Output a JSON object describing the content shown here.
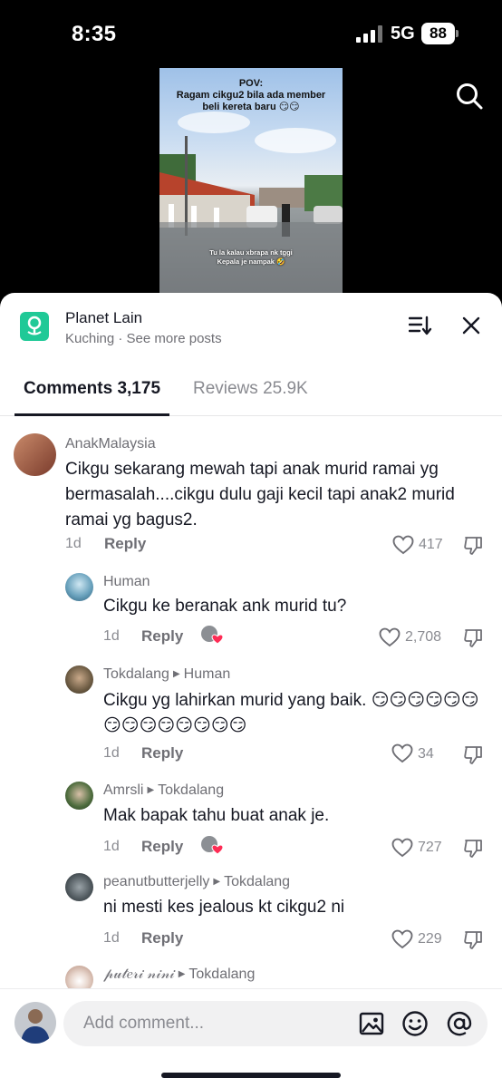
{
  "status_bar": {
    "time": "8:35",
    "network": "5G",
    "battery": "88"
  },
  "video": {
    "caption": "POV:\nRagam cikgu2 bila ada member\nbeli kereta baru 😏😏",
    "subtitle": "Tu la kalau xbrapa nk tggi\nKepala je nampak 🤣"
  },
  "shop": {
    "name": "Planet Lain",
    "meta": "Kuching · See more posts"
  },
  "tabs": [
    {
      "label": "Comments 3,175",
      "active": true
    },
    {
      "label": "Reviews 25.9K",
      "active": false
    }
  ],
  "comments": [
    {
      "user": "AnakMalaysia",
      "reply_to": "",
      "text": "Cikgu sekarang mewah tapi anak murid ramai yg bermasalah....cikgu dulu gaji kecil tapi anak2 murid ramai yg bagus2.",
      "date": "1d",
      "reply_label": "Reply",
      "likes": "417",
      "creator_liked": false
    },
    {
      "user": "Human",
      "reply_to": "",
      "text": "Cikgu ke beranak ank murid tu?",
      "date": "1d",
      "reply_label": "Reply",
      "likes": "2,708",
      "creator_liked": true
    },
    {
      "user": "Tokdalang",
      "reply_to": "Human",
      "text": "Cikgu yg lahirkan murid yang baik. 😏😏😏😏😏😏😏😏😏😏😏😏😏😏",
      "date": "1d",
      "reply_label": "Reply",
      "likes": "34",
      "creator_liked": false
    },
    {
      "user": "Amrsli",
      "reply_to": "Tokdalang",
      "text": "Mak bapak tahu buat anak je.",
      "date": "1d",
      "reply_label": "Reply",
      "likes": "727",
      "creator_liked": true
    },
    {
      "user": "peanutbutterjelly",
      "reply_to": "Tokdalang",
      "text": "ni mesti kes jealous kt cikgu2 ni",
      "date": "1d",
      "reply_label": "Reply",
      "likes": "229",
      "creator_liked": false
    },
    {
      "user": "𝓅𝓊𝓉𝑒𝓇𝒾 𝓃𝒾𝓃𝒾",
      "reply_to": "Tokdalang",
      "text": "",
      "date": "",
      "reply_label": "",
      "likes": "",
      "creator_liked": false
    }
  ],
  "composer": {
    "placeholder": "Add comment..."
  },
  "icons": {
    "search": "search-icon",
    "sort": "sort-icon",
    "close": "close-icon",
    "like": "heart-icon",
    "dislike": "thumbs-down-icon",
    "image": "image-icon",
    "emoji": "emoji-icon",
    "mention": "at-icon"
  },
  "colors": {
    "brand": "#20c997",
    "text": "#161823",
    "muted": "#8a8b91",
    "creator_heart": "#fe2c55"
  }
}
